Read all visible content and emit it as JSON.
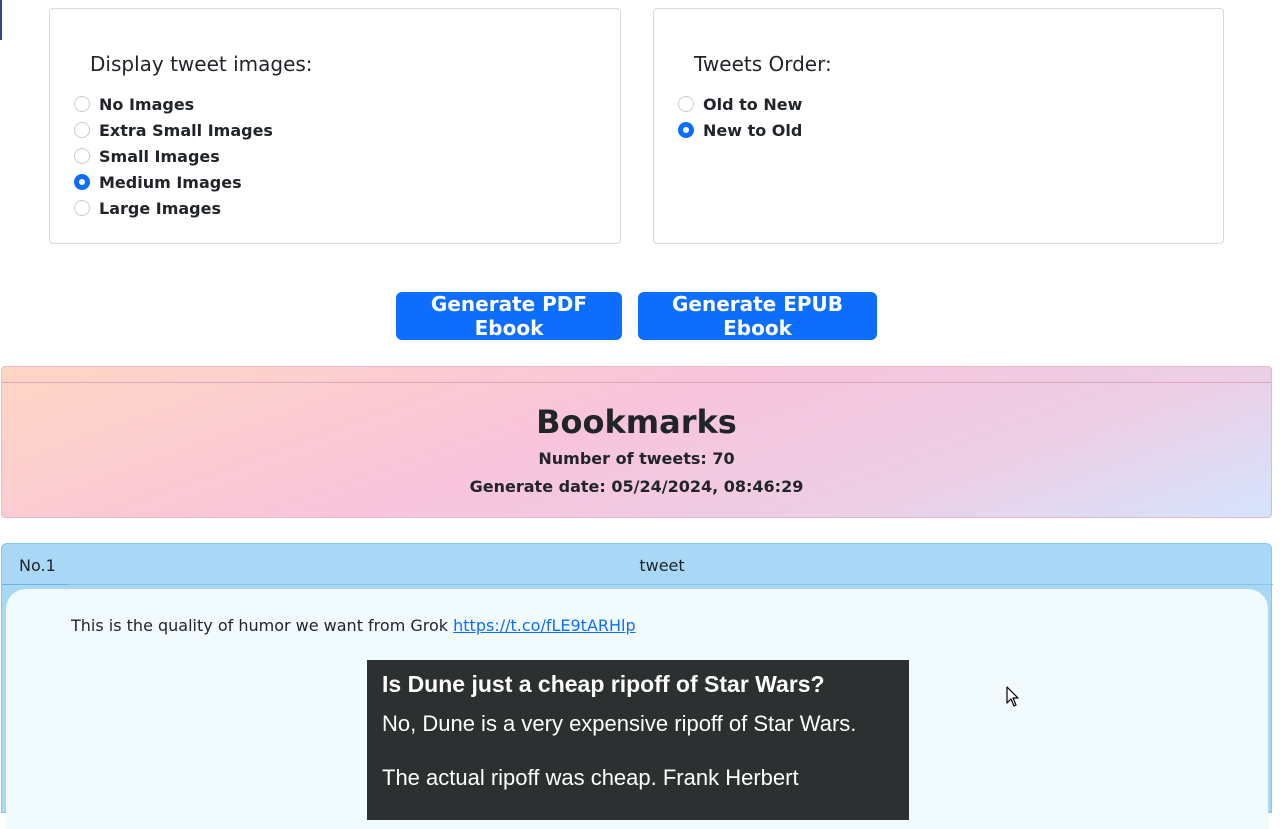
{
  "image_options": {
    "title": "Display tweet images:",
    "options": [
      {
        "label": "No Images",
        "checked": false
      },
      {
        "label": "Extra Small Images",
        "checked": false
      },
      {
        "label": "Small Images",
        "checked": false
      },
      {
        "label": "Medium Images",
        "checked": true
      },
      {
        "label": "Large Images",
        "checked": false
      }
    ]
  },
  "order_options": {
    "title": "Tweets Order:",
    "options": [
      {
        "label": "Old to New",
        "checked": false
      },
      {
        "label": "New to Old",
        "checked": true
      }
    ]
  },
  "buttons": {
    "pdf_label": "Generate PDF Ebook",
    "epub_label": "Generate EPUB Ebook"
  },
  "bookmarks": {
    "title": "Bookmarks",
    "count": "Number of tweets: 70",
    "date": "Generate date: 05/24/2024, 08:46:29"
  },
  "tweet": {
    "number": "No.1",
    "label": "tweet",
    "text": "This is the quality of humor we want from Grok ",
    "link": "https://t.co/fLE9tARHlp",
    "image": {
      "question": "Is Dune just a cheap ripoff of Star Wars?",
      "answer1": "No, Dune is a very expensive ripoff of Star Wars.",
      "answer2": "The actual ripoff was cheap. Frank Herbert"
    }
  },
  "colors": {
    "accent": "#0d6efd",
    "tweet_header": "#a8d8f6",
    "tweet_body": "#f1fbfe",
    "image_bg": "#2d3031"
  }
}
